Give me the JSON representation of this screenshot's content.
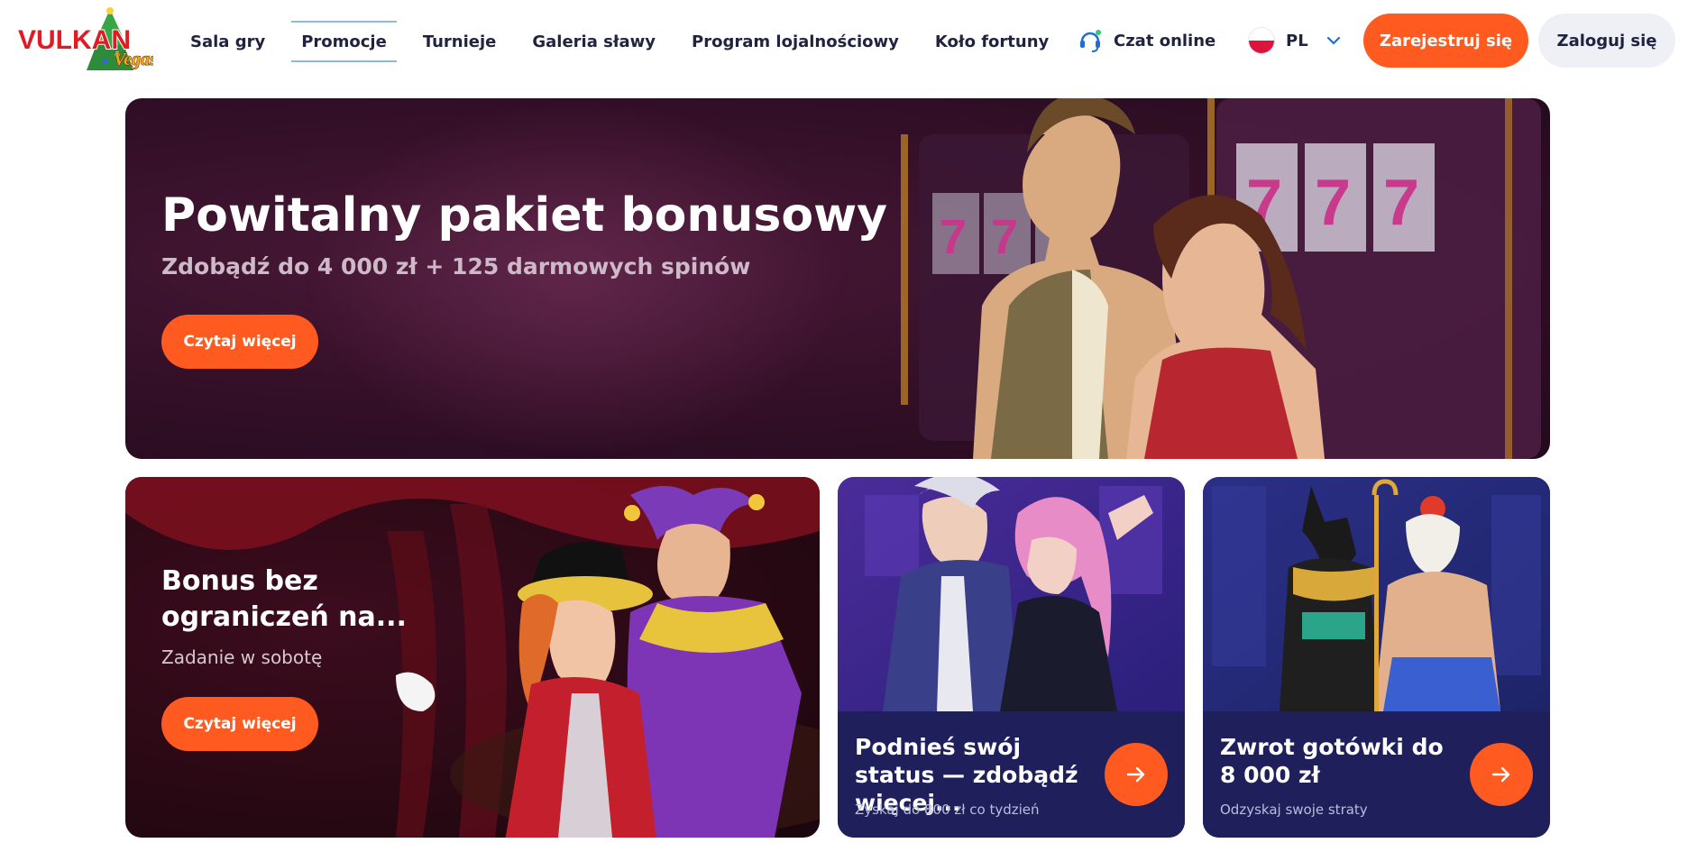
{
  "brand": {
    "name": "VULKAN",
    "sub": "Vegas"
  },
  "nav": {
    "items": [
      {
        "label": "Sala gry"
      },
      {
        "label": "Promocje"
      },
      {
        "label": "Turnieje"
      },
      {
        "label": "Galeria sławy"
      },
      {
        "label": "Program lojalnościowy"
      },
      {
        "label": "Koło fortuny"
      }
    ],
    "active_index": 1
  },
  "chat": {
    "label": "Czat online"
  },
  "language": {
    "code": "PL"
  },
  "auth": {
    "register_label": "Zarejestruj się",
    "login_label": "Zaloguj się"
  },
  "hero": {
    "title": "Powitalny pakiet bonusowy",
    "subtitle": "Zdobądź do 4 000 zł + 125 darmowych spinów",
    "button": "Czytaj więcej"
  },
  "cards": [
    {
      "title": "Bonus bez ograniczeń na...",
      "subtitle": "Zadanie w sobotę",
      "button": "Czytaj więcej"
    },
    {
      "title": "Podnieś swój status — zdobądź więcej...",
      "subtitle": "Zyskaj do 800 zł co tydzień"
    },
    {
      "title": "Zwrot gotówki do 8 000 zł",
      "subtitle": "Odzyskaj swoje straty"
    }
  ],
  "colors": {
    "accent": "#ff5a1f",
    "text": "#1f2340",
    "active_underline": "#8fb7e8",
    "card_bottom": "#1f1f5c"
  }
}
